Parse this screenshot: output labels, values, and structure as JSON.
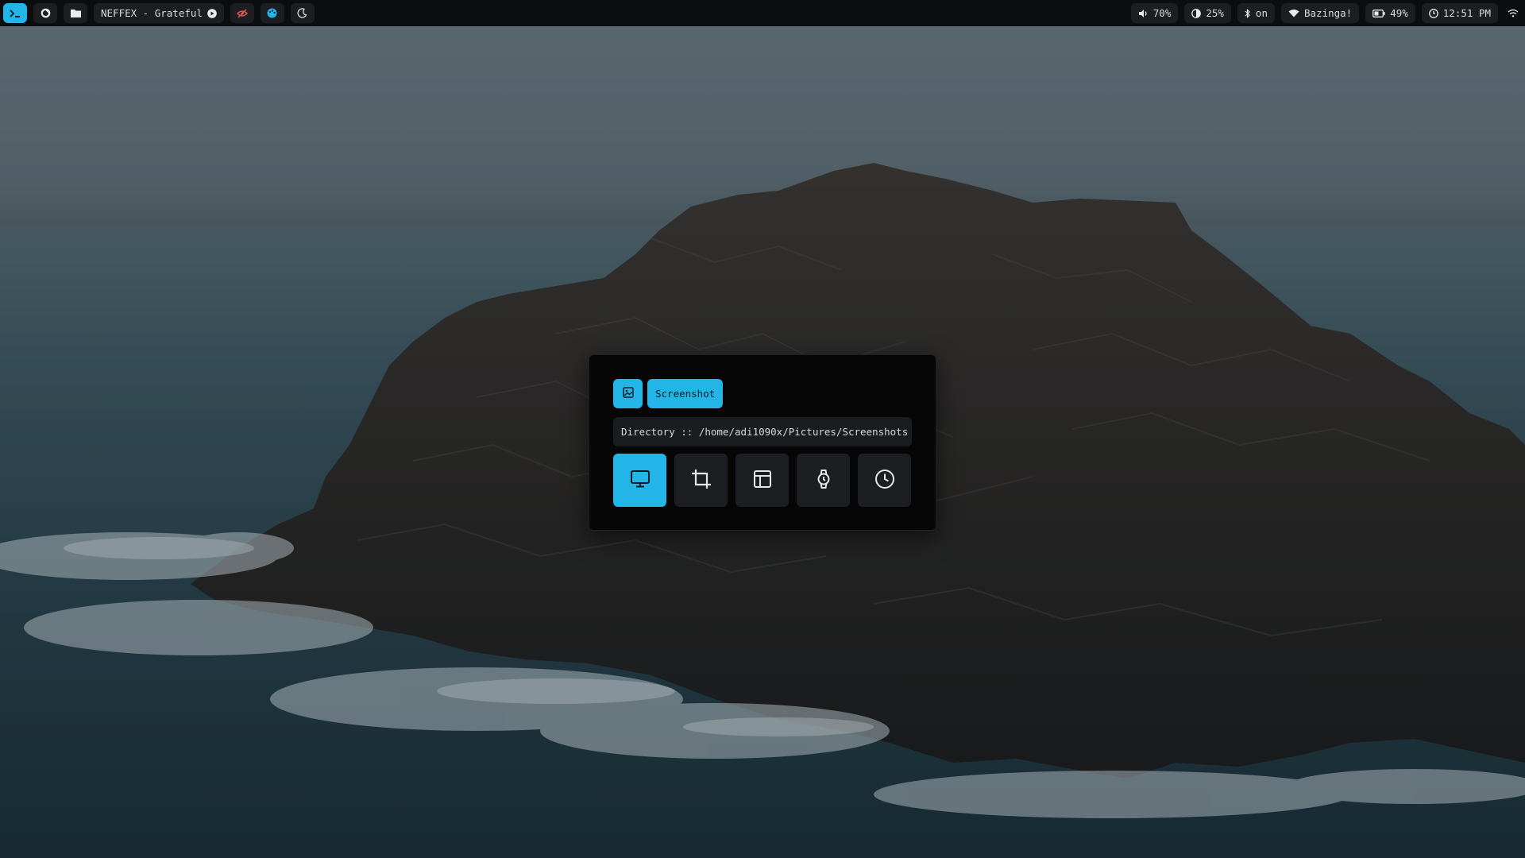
{
  "colors": {
    "accent": "#23b5e8",
    "bar_background": "#0c0d0f",
    "chip_background": "#1c1e22",
    "popup_background": "#060607",
    "record_icon": "#e25555"
  },
  "topbar": {
    "left": {
      "launcher_icon": "terminal-icon",
      "power_icon": "power-icon",
      "files_icon": "folder-icon",
      "media_label": "NEFFEX - Grateful",
      "media_icon": "play-icon",
      "record_icon": "eye-off-icon",
      "palette_icon": "palette-icon",
      "night_icon": "moon-icon"
    },
    "right": {
      "volume": "70%",
      "brightness": "25%",
      "bluetooth": "on",
      "wifi": "Bazinga!",
      "battery": "49%",
      "clock": "12:51 PM",
      "network_icon": "wifi-icon"
    }
  },
  "screenshot_popup": {
    "title": "Screenshot",
    "header_icon": "image-icon",
    "directory": "Directory :: /home/adi1090x/Pictures/Screenshots",
    "modes": [
      {
        "icon": "monitor-icon",
        "active": true
      },
      {
        "icon": "crop-icon",
        "active": false
      },
      {
        "icon": "window-icon",
        "active": false
      },
      {
        "icon": "watch-icon",
        "active": false
      },
      {
        "icon": "clock-icon",
        "active": false
      }
    ]
  }
}
